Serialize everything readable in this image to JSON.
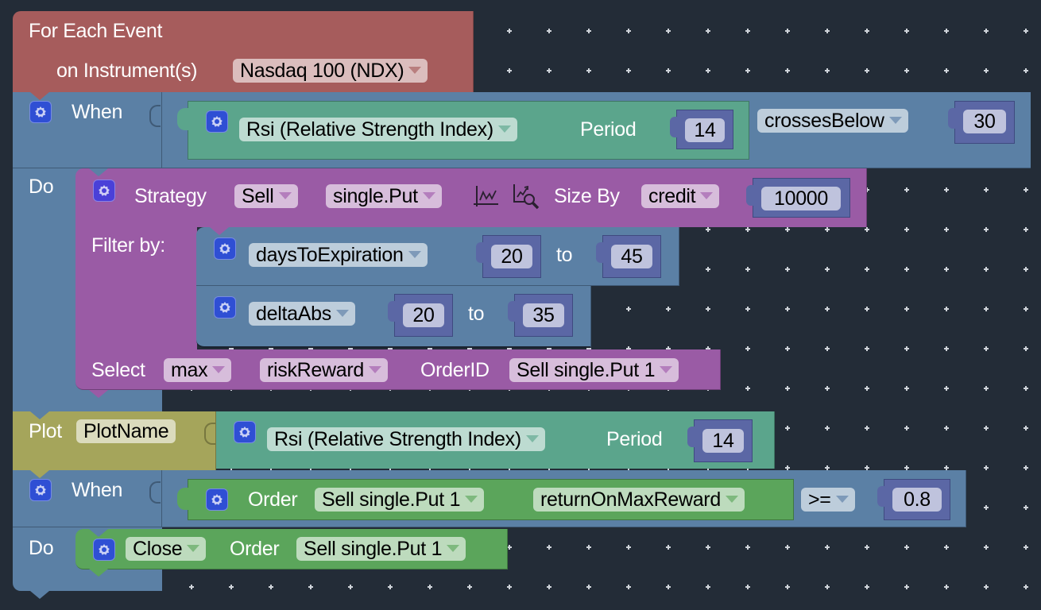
{
  "colors": {
    "background": "#232c37",
    "event_block": "#a65c5c",
    "control_block": "#5b80a5",
    "indicator_block": "#5ba58c",
    "strategy_block": "#9a5ba5",
    "plot_block": "#a5a55b",
    "order_block": "#5ba55b",
    "number_block": "#5b67a5",
    "gear_icon": "#2f4fd4"
  },
  "event_block": {
    "title": "For Each Event",
    "instrument_label": "on Instrument(s)",
    "instrument_value": "Nasdaq 100 (NDX)"
  },
  "when_block_1": {
    "when_label": "When",
    "do_label": "Do",
    "condition": {
      "indicator": "Rsi (Relative Strength Index)",
      "period_label": "Period",
      "period_value": "14",
      "comparator": "crossesBelow",
      "threshold": "30"
    }
  },
  "strategy_block": {
    "strategy_label": "Strategy",
    "side": "Sell",
    "type": "single.Put",
    "icons": [
      "payoff-chart-icon",
      "analyze-chart-icon"
    ],
    "size_by_label": "Size By",
    "size_by": "credit",
    "size_value": "10000",
    "filter_label": "Filter by:",
    "filters": [
      {
        "field": "daysToExpiration",
        "from": "20",
        "to_label": "to",
        "to": "45"
      },
      {
        "field": "deltaAbs",
        "from": "20",
        "to_label": "to",
        "to": "35"
      }
    ],
    "select_label": "Select",
    "select_mode": "max",
    "select_metric": "riskReward",
    "order_id_label": "OrderID",
    "order_id": "Sell single.Put 1"
  },
  "plot_block": {
    "plot_label": "Plot",
    "plot_name": "PlotName",
    "indicator": "Rsi (Relative Strength Index)",
    "period_label": "Period",
    "period_value": "14"
  },
  "when_block_2": {
    "when_label": "When",
    "do_label": "Do",
    "condition": {
      "order_label": "Order",
      "order": "Sell single.Put 1",
      "metric": "returnOnMaxReward",
      "comparator": ">=",
      "threshold": "0.8"
    },
    "action": {
      "action": "Close",
      "order_label": "Order",
      "order": "Sell single.Put 1"
    }
  }
}
